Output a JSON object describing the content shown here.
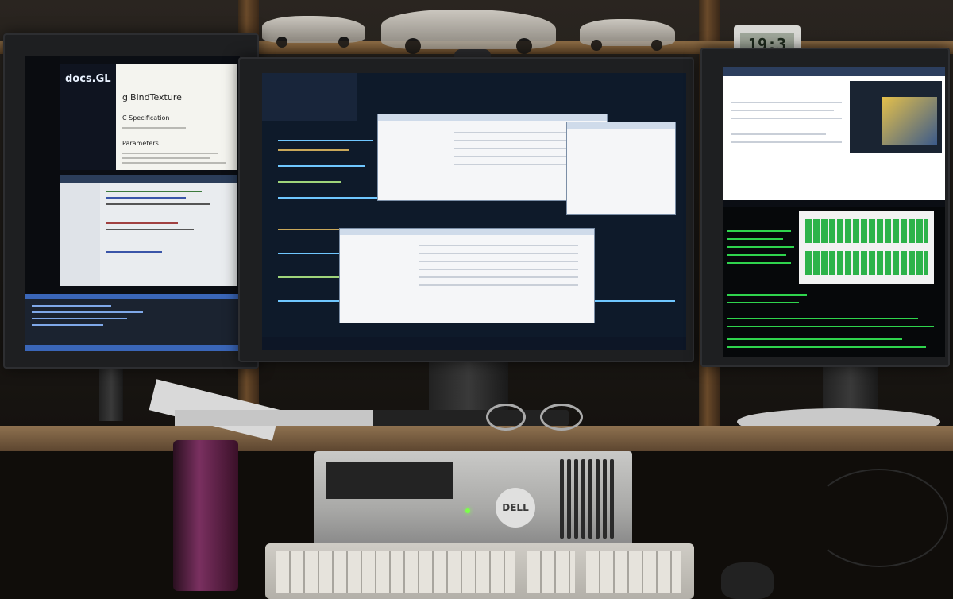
{
  "scene": {
    "description_label": "Triple-monitor developer workstation",
    "palette": {
      "wall": "#2a2520",
      "wood": "#8a6a44",
      "bezel": "#1e1f21",
      "code_background": "#0e1a2a",
      "terminal_green": "#2fd44d",
      "doc_page": "#f4f4ef",
      "tower_silver": "#b9b9b7"
    }
  },
  "left_monitor": {
    "doc_site": "docs.GL",
    "doc_function": "glBindTexture",
    "section_c_spec": "C Specification",
    "section_params": "Parameters"
  },
  "right_monitor": {
    "clock_display": "19:3"
  },
  "tower": {
    "brand": "DELL"
  },
  "icons": [
    "power-led-icon",
    "dell-logo-icon"
  ]
}
